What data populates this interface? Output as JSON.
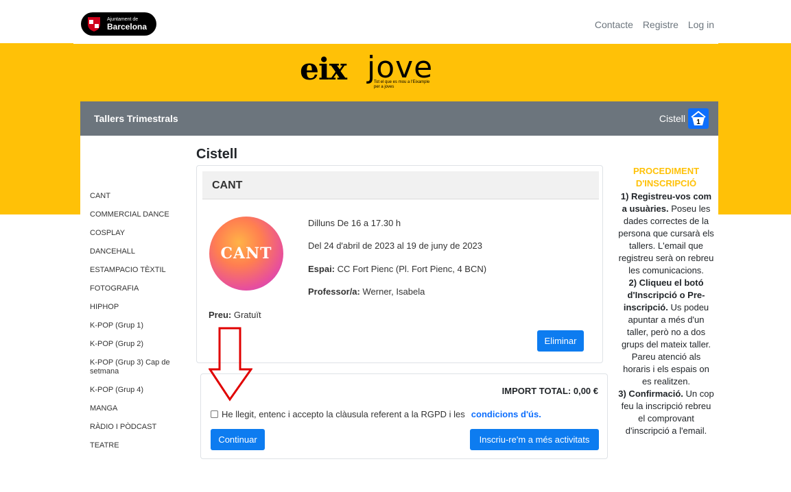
{
  "header": {
    "city_small": "Ajuntament de",
    "city_big": "Barcelona",
    "links": [
      "Contacte",
      "Registre",
      "Log in"
    ]
  },
  "brand": {
    "name_bold": "eix",
    "name_light": "jove",
    "tagline": "Tot el que es mou a l'Eixample per a joves"
  },
  "navbar": {
    "title": "Tallers Trimestrals",
    "cart_label": "Cistell",
    "cart_count": "1"
  },
  "sidebar": {
    "items": [
      "CANT",
      "COMMERCIAL DANCE",
      "COSPLAY",
      "DANCEHALL",
      "ESTAMPACIO TÈXTIL",
      "FOTOGRAFIA",
      "HIPHOP",
      "K-POP (Grup 1)",
      "K-POP (Grup 2)",
      "K-POP (Grup 3) Cap de setmana",
      "K-POP (Grup 4)",
      "MANGA",
      "RÀDIO I PÒDCAST",
      "TEATRE"
    ]
  },
  "main": {
    "heading": "Cistell",
    "course": {
      "title": "CANT",
      "image_text": "CANT",
      "schedule": "Dilluns De 16 a 17.30 h",
      "dates": "Del 24 d'abril de 2023 al 19 de juny de 2023",
      "space_label": "Espai:",
      "space_value": "CC Fort Pienc (Pl. Fort Pienc, 4 BCN)",
      "teacher_label": "Professor/a:",
      "teacher_value": "Werner, Isabela",
      "price_label": "Preu:",
      "price_value": "Gratuït",
      "delete_label": "Eliminar"
    },
    "total": "IMPORT TOTAL: 0,00 €",
    "consent_text": "He llegit, entenc i accepto la clàusula referent a la RGPD i les",
    "consent_link": "condicions d'ús.",
    "continue_label": "Continuar",
    "more_label": "Inscriu-re'm a més activitats"
  },
  "procedure": {
    "title": "PROCEDIMENT D'INSCRIPCIÓ",
    "step1_bold": "1) Registreu-vos com a usuàries.",
    "step1_text": "Poseu les dades correctes de la persona que cursarà els tallers. L'email que registreu serà on rebreu les comunicacions.",
    "step2_bold": "2) Cliqueu el botó d'Inscripció o Pre-inscripció.",
    "step2_text": "Us podeu apuntar a més d'un taller, però no a dos grups del mateix taller. Pareu atenció als horaris i els espais on es realitzen.",
    "step3_bold": "3) Confirmació.",
    "step3_text": "Un cop feu la inscripció rebreu el comprovant d'inscripció a l'email."
  },
  "colors": {
    "brand_yellow": "#ffc107",
    "nav_gray": "#6c757d",
    "button_blue": "#0d7cf0",
    "annotation_red": "#e00000"
  }
}
